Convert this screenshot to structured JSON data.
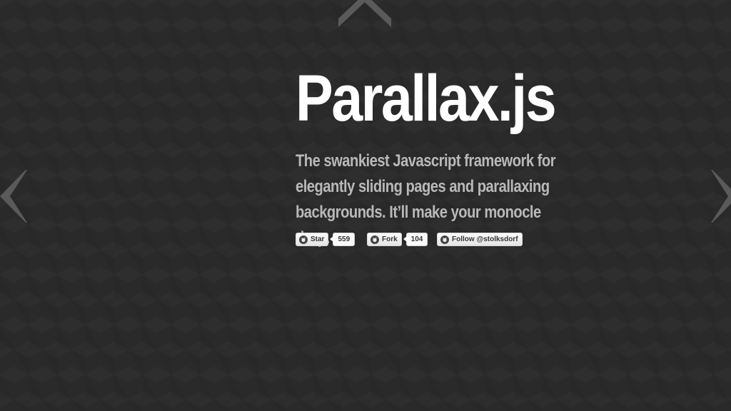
{
  "page": {
    "title": "Parallax.js",
    "tagline": "The swankiest Javascript framework for elegantly sliding pages and parallaxing backgrounds. It’ll make your monocle drop."
  },
  "navigation": {
    "up_icon": "chevron-up-icon",
    "left_icon": "chevron-left-icon",
    "right_icon": "chevron-right-icon"
  },
  "github_buttons": {
    "star": {
      "label": "Star",
      "count": "559",
      "icon": "github-octocat-icon"
    },
    "fork": {
      "label": "Fork",
      "count": "104",
      "icon": "github-octocat-icon"
    },
    "follow": {
      "label": "Follow @stolksdorf",
      "icon": "github-octocat-icon"
    }
  },
  "colors": {
    "background": "#2a2a2a",
    "title": "#ffffff",
    "tagline": "#b9b9b9",
    "arrows": "#5a5a5a"
  }
}
